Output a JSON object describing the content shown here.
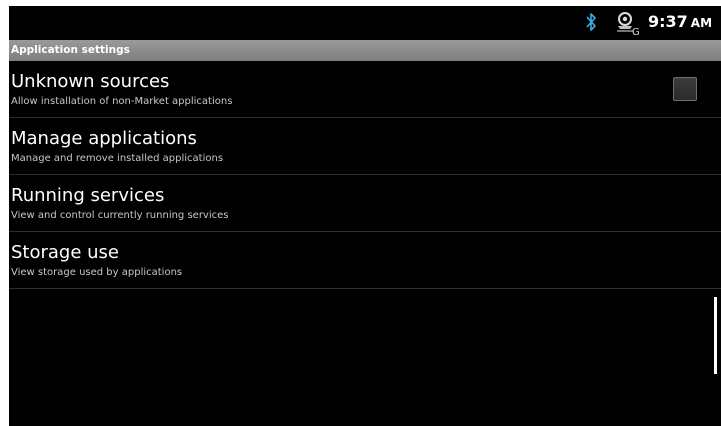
{
  "status_bar": {
    "icons": [
      "bluetooth-icon",
      "gps-icon"
    ],
    "time": "9:37",
    "ampm": "AM",
    "bluetooth_color": "#33b5e5"
  },
  "section": {
    "title": "Application settings"
  },
  "items": [
    {
      "title": "Unknown sources",
      "summary": "Allow installation of non-Market applications",
      "checkbox": true,
      "checked": false
    },
    {
      "title": "Manage applications",
      "summary": "Manage and remove installed applications"
    },
    {
      "title": "Running services",
      "summary": "View and control currently running services"
    },
    {
      "title": "Storage use",
      "summary": "View storage used by applications"
    }
  ]
}
